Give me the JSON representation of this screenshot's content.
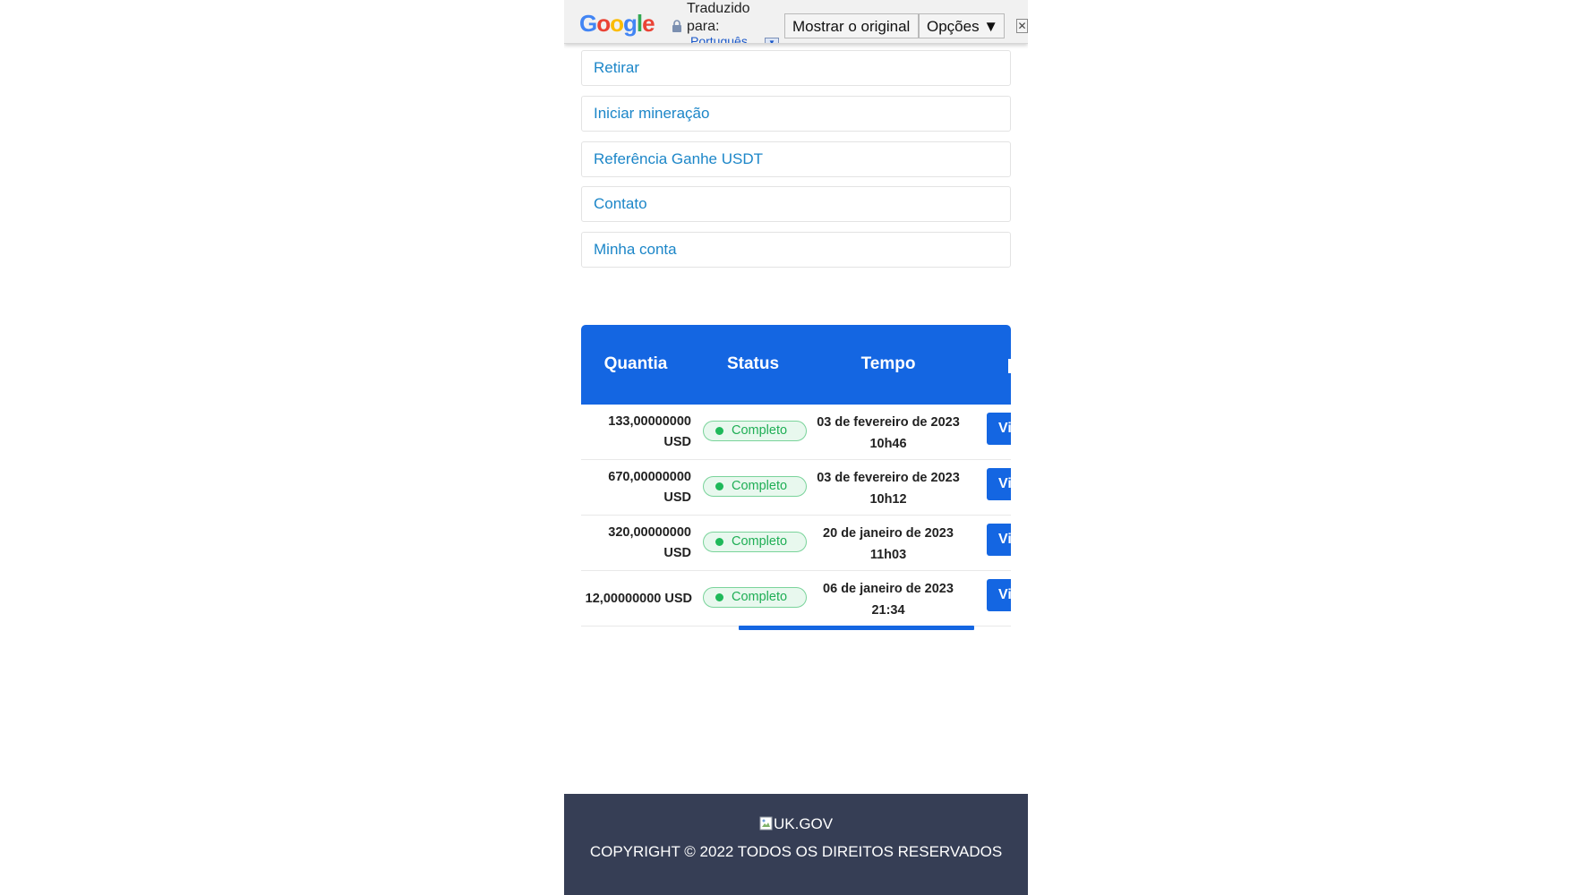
{
  "translate_bar": {
    "logo": [
      "G",
      "o",
      "o",
      "g",
      "l",
      "e"
    ],
    "logo_colors": [
      "#4285f4",
      "#ea4335",
      "#fbbc05",
      "#4285f4",
      "#34a853",
      "#ea4335"
    ],
    "label": "Traduzido para:",
    "language": "Português",
    "show_original": "Mostrar o original",
    "options": "Opções ▼",
    "close": "✕"
  },
  "menu": {
    "items": [
      {
        "label": "Retirar"
      },
      {
        "label": "Iniciar mineração"
      },
      {
        "label": "Referência Ganhe USDT"
      },
      {
        "label": "Contato"
      },
      {
        "label": "Minha conta"
      }
    ]
  },
  "table": {
    "headers": {
      "amount": "Quantia",
      "status": "Status",
      "time": "Tempo"
    },
    "rows": [
      {
        "amount_line1": "133,00000000",
        "amount_line2": "USD",
        "status": "Completo",
        "time_line1": "03 de fevereiro de 2023",
        "time_line2": "10h46",
        "action": "Vi"
      },
      {
        "amount_line1": "670,00000000",
        "amount_line2": "USD",
        "status": "Completo",
        "time_line1": "03 de fevereiro de 2023",
        "time_line2": "10h12",
        "action": "Vi"
      },
      {
        "amount_line1": "320,00000000",
        "amount_line2": "USD",
        "status": "Completo",
        "time_line1": "20 de janeiro de 2023",
        "time_line2": "11h03",
        "action": "Vi"
      },
      {
        "amount_line1": "12,00000000 USD",
        "amount_line2": "",
        "status": "Completo",
        "time_line1": "06 de janeiro de 2023",
        "time_line2": "21:34",
        "action": "Vi"
      }
    ]
  },
  "footer": {
    "logo_alt": "UK.GOV",
    "copyright": "COPYRIGHT © 2022 TODOS OS DIREITOS RESERVADOS"
  },
  "colors": {
    "primary": "#1466e2",
    "link": "#1c86c8",
    "success": "#1fb95a",
    "footer_bg": "#363e55"
  }
}
